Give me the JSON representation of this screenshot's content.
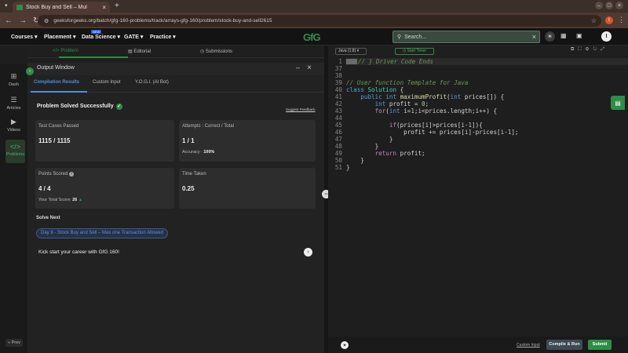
{
  "browser": {
    "tab_title": "Stock Buy and Sell – Mul",
    "url": "geeksforgeeks.org/batch/gfg-160-problems/track/arrays-gfg-160/problem/stock-buy-and-sell2615",
    "profile_initial": "I",
    "ext_initial": "t"
  },
  "nav": {
    "items": [
      "Courses ▾",
      "Placement ▾",
      "Data Science ▾",
      "GATE ▾",
      "Practice ▾"
    ],
    "new_badge": "NEW",
    "logo": "GfG",
    "search_placeholder": "Search...",
    "avatar_initial": "I"
  },
  "subheader": {
    "problem": "Problem",
    "editorial": "Editorial",
    "submissions": "Submissions"
  },
  "rail": {
    "dash": "Dash",
    "articles": "Articles",
    "videos": "Videos",
    "problems": "Problems",
    "prev": "« Prev"
  },
  "output": {
    "title": "Output Window",
    "tabs": [
      "Compilation Results",
      "Custom Input",
      "Y.O.G.I. (AI Bot)"
    ],
    "solved_text": "Problem Solved Successfully",
    "feedback": "Suggest Feedback",
    "cards": {
      "tests_label": "Test Cases Passed",
      "tests_value": "1115 / 1115",
      "attempts_label": "Attempts : Correct / Total",
      "attempts_value": "1 / 1",
      "accuracy_label": "Accuracy :",
      "accuracy_value": "100%",
      "points_label": "Points Scored",
      "points_value": "4 / 4",
      "total_label": "Your Total Score:",
      "total_value": "26",
      "time_label": "Time Taken",
      "time_value": "0.25"
    },
    "solve_next": "Solve Next",
    "next_problem": "Day 8 - Stock Buy and Sell – Max one Transaction Allowed",
    "kickstart": "Kick start your career with GfG 160!"
  },
  "editor": {
    "language": "Java (1.8)",
    "timer": "Start Timer",
    "custom_input": "Custom Input",
    "compile_run": "Compile & Run",
    "submit": "Submit",
    "lines": [
      {
        "n": "1",
        "t": "// } Driver Code Ends"
      },
      {
        "n": "37",
        "t": ""
      },
      {
        "n": "38",
        "t": ""
      },
      {
        "n": "39",
        "t": "// User function Template for Java"
      },
      {
        "n": "40",
        "t": "class Solution {"
      },
      {
        "n": "41",
        "t": "    public int maximumProfit(int prices[]) {"
      },
      {
        "n": "42",
        "t": "        int profit = 0;"
      },
      {
        "n": "43",
        "t": "        for(int i=1;i<prices.length;i++) {"
      },
      {
        "n": "44",
        "t": ""
      },
      {
        "n": "45",
        "t": "            if(prices[i]>prices[i-1]){"
      },
      {
        "n": "46",
        "t": "                profit += prices[i]-prices[i-1];"
      },
      {
        "n": "47",
        "t": "            }"
      },
      {
        "n": "48",
        "t": "        }"
      },
      {
        "n": "49",
        "t": "        return profit;"
      },
      {
        "n": "50",
        "t": "    }"
      },
      {
        "n": "51",
        "t": "}"
      }
    ]
  },
  "colors": {
    "gfg_green": "#2f8d46",
    "accent_blue": "#4a90e2"
  }
}
